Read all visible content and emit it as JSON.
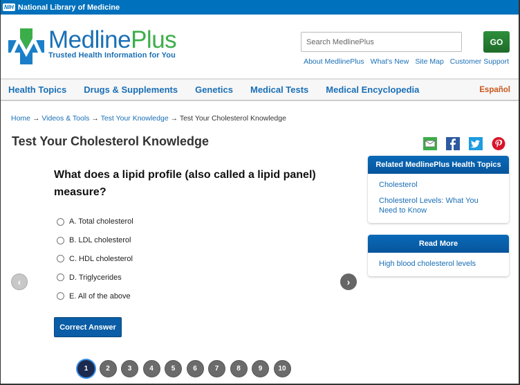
{
  "topbar": {
    "badge": "NIH",
    "title": "National Library of Medicine"
  },
  "logo": {
    "name_part1": "Medline",
    "name_part2": "Plus",
    "tagline": "Trusted Health Information for You"
  },
  "search": {
    "placeholder": "Search MedlinePlus",
    "value": "",
    "go_label": "GO"
  },
  "util_links": [
    "About MedlinePlus",
    "What's New",
    "Site Map",
    "Customer Support"
  ],
  "nav": {
    "items": [
      "Health Topics",
      "Drugs & Supplements",
      "Genetics",
      "Medical Tests",
      "Medical Encyclopedia"
    ],
    "language": "Español"
  },
  "breadcrumb": {
    "items": [
      "Home",
      "Videos & Tools",
      "Test Your Knowledge"
    ],
    "current": "Test Your Cholesterol Knowledge",
    "separator": "→"
  },
  "page": {
    "title": "Test Your Cholesterol Knowledge"
  },
  "share": [
    "email-icon",
    "facebook-icon",
    "twitter-icon",
    "pinterest-icon"
  ],
  "quiz": {
    "question": "What does a lipid profile (also called a lipid panel) measure?",
    "options": [
      "A. Total cholesterol",
      "B. LDL cholesterol",
      "C. HDL cholesterol",
      "D. Triglycerides",
      "E. All of the above"
    ],
    "selected": null,
    "answer_button": "Correct Answer",
    "prev": "‹",
    "next": "›",
    "pages": [
      "1",
      "2",
      "3",
      "4",
      "5",
      "6",
      "7",
      "8",
      "9",
      "10"
    ],
    "current_page": 1
  },
  "sidebar": {
    "related": {
      "title": "Related MedlinePlus Health Topics",
      "links": [
        "Cholesterol",
        "Cholesterol Levels: What You Need to Know"
      ]
    },
    "read_more": {
      "title": "Read More",
      "links": [
        "High blood cholesterol levels"
      ]
    }
  },
  "colors": {
    "brand_blue": "#0071bc",
    "link_blue": "#1a6fb5",
    "brand_green": "#3cae49",
    "go_green": "#2d8f3a",
    "espanol_orange": "#c8581c",
    "button_blue": "#0a5da6"
  }
}
